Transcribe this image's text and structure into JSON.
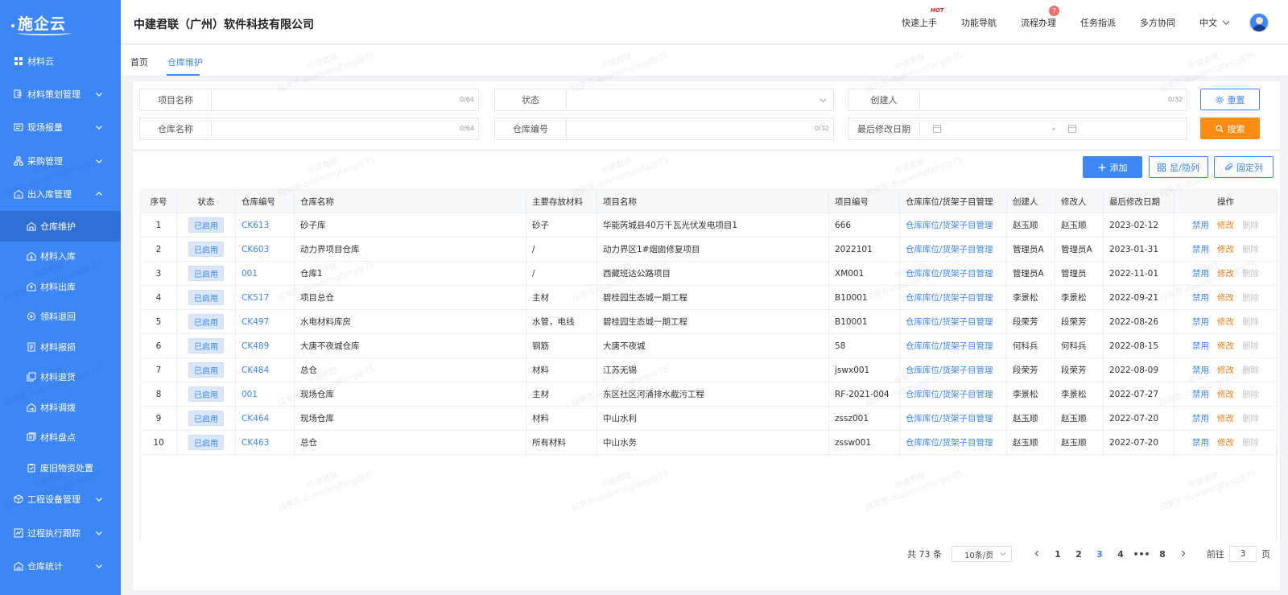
{
  "app": {
    "logo": "施企云",
    "company": "中建君联（广州）软件科技有限公司"
  },
  "sidebar": {
    "items": [
      {
        "label": "材料云",
        "icon": "grid-icon",
        "type": "top"
      },
      {
        "label": "材料策划管理",
        "icon": "layers-icon",
        "type": "group",
        "expanded": false
      },
      {
        "label": "现场报量",
        "icon": "report-icon",
        "type": "group",
        "expanded": false
      },
      {
        "label": "采购管理",
        "icon": "sitemap-icon",
        "type": "group",
        "expanded": false
      },
      {
        "label": "出入库管理",
        "icon": "exchange-icon",
        "type": "group",
        "expanded": true
      },
      {
        "label": "仓库维护",
        "icon": "warehouse-icon",
        "type": "child",
        "active": true
      },
      {
        "label": "材料入库",
        "icon": "warehouse-in-icon",
        "type": "child"
      },
      {
        "label": "材料出库",
        "icon": "warehouse-out-icon",
        "type": "child"
      },
      {
        "label": "领料退回",
        "icon": "return-icon",
        "type": "child"
      },
      {
        "label": "材料报损",
        "icon": "document-icon",
        "type": "child"
      },
      {
        "label": "材料退货",
        "icon": "copy-icon",
        "type": "child"
      },
      {
        "label": "材料调拨",
        "icon": "transfer-icon",
        "type": "child"
      },
      {
        "label": "材料盘点",
        "icon": "stack-icon",
        "type": "child"
      },
      {
        "label": "废旧物资处置",
        "icon": "clipboard-icon",
        "type": "child"
      },
      {
        "label": "工程设备管理",
        "icon": "cube-icon",
        "type": "group",
        "expanded": false
      },
      {
        "label": "过程执行跟踪",
        "icon": "track-icon",
        "type": "group",
        "expanded": false
      },
      {
        "label": "仓库统计",
        "icon": "chart-icon",
        "type": "group",
        "expanded": false
      }
    ]
  },
  "header": {
    "nav": [
      {
        "label": "快速上手",
        "badge": "HOT"
      },
      {
        "label": "功能导航"
      },
      {
        "label": "流程办理",
        "count": "7"
      },
      {
        "label": "任务指派"
      },
      {
        "label": "多方协同"
      }
    ],
    "language": "中文"
  },
  "tabs": [
    {
      "label": "首页"
    },
    {
      "label": "仓库维护",
      "active": true
    }
  ],
  "filters": {
    "project_name": {
      "label": "项目名称",
      "counter": "0/64"
    },
    "status": {
      "label": "状态"
    },
    "creator": {
      "label": "创建人",
      "counter": "0/32"
    },
    "warehouse_name": {
      "label": "仓库名称",
      "counter": "0/64"
    },
    "warehouse_code": {
      "label": "仓库编号",
      "counter": "0/32"
    },
    "modified_date": {
      "label": "最后修改日期",
      "separator": "-"
    },
    "reset_label": "重置",
    "search_label": "搜索"
  },
  "toolbar": {
    "add_label": "添加",
    "toggle_label": "显/隐列",
    "pin_label": "固定列"
  },
  "table": {
    "headers": [
      "序号",
      "状态",
      "仓库编号",
      "仓库名称",
      "主要存放材料",
      "项目名称",
      "项目编号",
      "仓库库位/货架子目管理",
      "创建人",
      "修改人",
      "最后修改日期",
      "操作"
    ],
    "rows": [
      [
        "1",
        "已启用",
        "CK613",
        "砂子库",
        "砂子",
        "华能芮城县40万千瓦光伏发电项目1",
        "666",
        "仓库库位/货架子目管理",
        "赵玉顺",
        "赵玉顺",
        "2023-02-12"
      ],
      [
        "2",
        "已启用",
        "CK603",
        "动力界项目仓库",
        "/",
        "动力界区1#烟囱修复项目",
        "2022101",
        "仓库库位/货架子目管理",
        "管理员A",
        "管理员A",
        "2023-01-31"
      ],
      [
        "3",
        "已启用",
        "001",
        "仓库1",
        "/",
        "西藏班达公路项目",
        "XM001",
        "仓库库位/货架子目管理",
        "管理员A",
        "管理员",
        "2022-11-01"
      ],
      [
        "4",
        "已启用",
        "CK517",
        "项目总仓",
        "主材",
        "碧桂园生态城一期工程",
        "B10001",
        "仓库库位/货架子目管理",
        "李景松",
        "李景松",
        "2022-09-21"
      ],
      [
        "5",
        "已启用",
        "CK497",
        "水电材料库房",
        "水管，电线",
        "碧桂园生态城一期工程",
        "B10001",
        "仓库库位/货架子目管理",
        "段荣芳",
        "段荣芳",
        "2022-08-26"
      ],
      [
        "6",
        "已启用",
        "CK489",
        "大唐不夜城仓库",
        "钢筋",
        "大唐不夜城",
        "58",
        "仓库库位/货架子目管理",
        "何科兵",
        "何科兵",
        "2022-08-15"
      ],
      [
        "7",
        "已启用",
        "CK484",
        "总仓",
        "材料",
        "江苏无锡",
        "jswx001",
        "仓库库位/货架子目管理",
        "段荣芳",
        "段荣芳",
        "2022-08-09"
      ],
      [
        "8",
        "已启用",
        "001",
        "现场仓库",
        "主材",
        "东区社区河涌排水截污工程",
        "RF-2021-004",
        "仓库库位/货架子目管理",
        "李景松",
        "李景松",
        "2022-07-27"
      ],
      [
        "9",
        "已启用",
        "CK464",
        "现场仓库",
        "材料",
        "中山水利",
        "zssz001",
        "仓库库位/货架子目管理",
        "赵玉顺",
        "赵玉顺",
        "2022-07-20"
      ],
      [
        "10",
        "已启用",
        "CK463",
        "总仓",
        "所有材料",
        "中山水务",
        "zssw001",
        "仓库库位/货架子目管理",
        "赵玉顺",
        "赵玉顺",
        "2022-07-20"
      ]
    ],
    "ops": {
      "disable": "禁用",
      "edit": "修改",
      "delete": "删除"
    }
  },
  "pagination": {
    "total": "共 73 条",
    "page_size": "10条/页",
    "pages": [
      "1",
      "2",
      "3",
      "4",
      "•••",
      "8"
    ],
    "current": "3",
    "goto_prefix": "前往",
    "goto_value": "3",
    "goto_suffix": "页"
  },
  "watermark": {
    "line1": "中建君联",
    "line2": "段荣芳-duanrongfang@75"
  }
}
